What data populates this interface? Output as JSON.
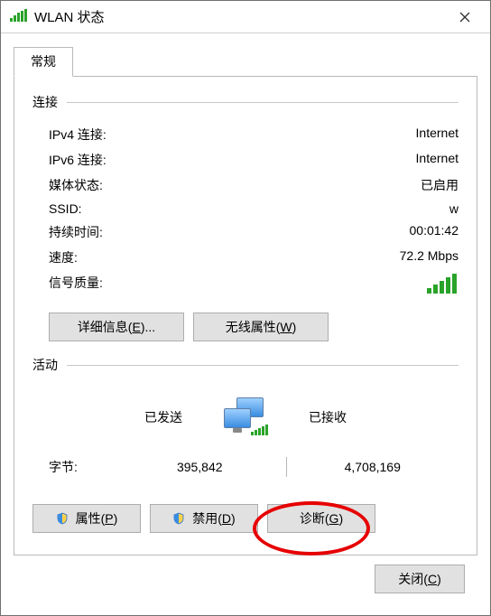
{
  "window": {
    "title": "WLAN 状态",
    "close_aria": "关闭"
  },
  "tab": {
    "general": "常规"
  },
  "groups": {
    "connection": "连接",
    "activity": "活动"
  },
  "conn": {
    "ipv4_label": "IPv4 连接:",
    "ipv4_value": "Internet",
    "ipv6_label": "IPv6 连接:",
    "ipv6_value": "Internet",
    "media_label": "媒体状态:",
    "media_value": "已启用",
    "ssid_label": "SSID:",
    "ssid_value": "w",
    "duration_label": "持续时间:",
    "duration_value": "00:01:42",
    "speed_label": "速度:",
    "speed_value": "72.2 Mbps",
    "signal_label": "信号质量:"
  },
  "buttons": {
    "details_prefix": "详细信息(",
    "details_key": "E",
    "details_suffix": ")...",
    "wireless_prefix": "无线属性(",
    "wireless_key": "W",
    "wireless_suffix": ")",
    "properties_prefix": "属性(",
    "properties_key": "P",
    "properties_suffix": ")",
    "disable_prefix": "禁用(",
    "disable_key": "D",
    "disable_suffix": ")",
    "diagnose_prefix": "诊断(",
    "diagnose_key": "G",
    "diagnose_suffix": ")",
    "close_prefix": "关闭(",
    "close_key": "C",
    "close_suffix": ")"
  },
  "activity": {
    "sent_label": "已发送",
    "recv_label": "已接收",
    "bytes_label": "字节:",
    "bytes_sent": "395,842",
    "bytes_recv": "4,708,169"
  }
}
